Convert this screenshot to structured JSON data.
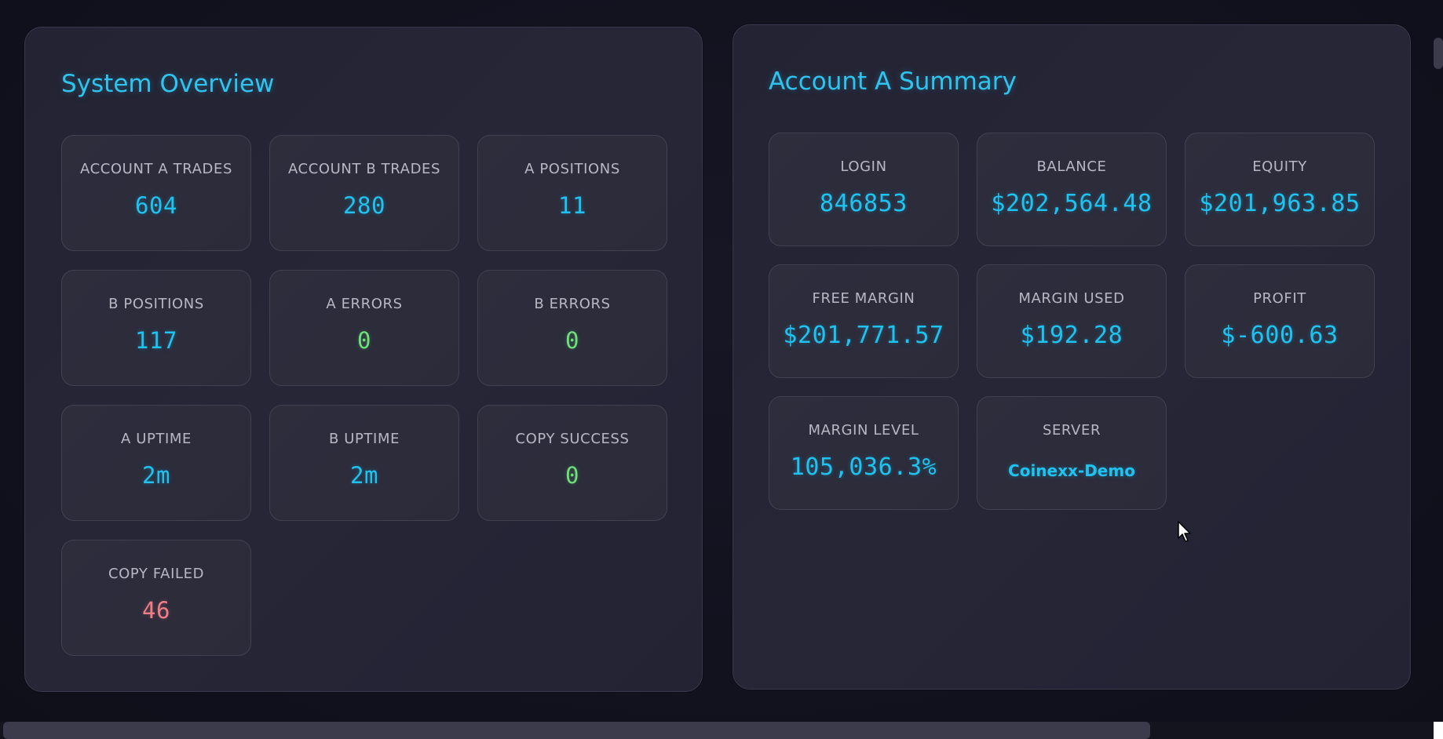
{
  "system_overview": {
    "title": "System Overview",
    "cards": [
      {
        "label": "ACCOUNT A TRADES",
        "value": "604",
        "status": "info"
      },
      {
        "label": "ACCOUNT B TRADES",
        "value": "280",
        "status": "info"
      },
      {
        "label": "A POSITIONS",
        "value": "11",
        "status": "info"
      },
      {
        "label": "B POSITIONS",
        "value": "117",
        "status": "info"
      },
      {
        "label": "A ERRORS",
        "value": "0",
        "status": "ok"
      },
      {
        "label": "B ERRORS",
        "value": "0",
        "status": "ok"
      },
      {
        "label": "A UPTIME",
        "value": "2m",
        "status": "info"
      },
      {
        "label": "B UPTIME",
        "value": "2m",
        "status": "info"
      },
      {
        "label": "COPY SUCCESS",
        "value": "0",
        "status": "ok"
      },
      {
        "label": "COPY FAILED",
        "value": "46",
        "status": "bad"
      }
    ]
  },
  "account_a_summary": {
    "title": "Account A Summary",
    "cards": [
      {
        "label": "LOGIN",
        "value": "846853"
      },
      {
        "label": "BALANCE",
        "value": "$202,564.48"
      },
      {
        "label": "EQUITY",
        "value": "$201,963.85"
      },
      {
        "label": "FREE MARGIN",
        "value": "$201,771.57"
      },
      {
        "label": "MARGIN USED",
        "value": "$192.28"
      },
      {
        "label": "PROFIT",
        "value": "$-600.63"
      },
      {
        "label": "MARGIN LEVEL",
        "value": "105,036.3%"
      },
      {
        "label": "SERVER",
        "value": "Coinexx-Demo"
      }
    ]
  },
  "colors": {
    "accent": "#1ec3f2",
    "ok": "#6ee07a",
    "bad": "#f07d87",
    "background": "#11111d",
    "panel": "#262637"
  },
  "icons": {
    "cursor": "mouse-pointer-icon"
  }
}
